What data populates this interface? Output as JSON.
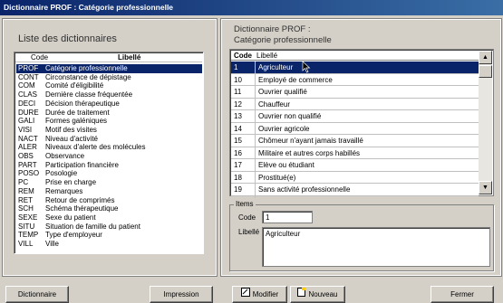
{
  "window": {
    "title": "Dictionnaire PROF : Catégorie professionnelle"
  },
  "left": {
    "title": "Liste des dictionnaires",
    "col_code": "Code",
    "col_label": "Libellé",
    "items": [
      {
        "code": "PROF",
        "label": "Catégorie professionnelle"
      },
      {
        "code": "CONT",
        "label": "Circonstance de dépistage"
      },
      {
        "code": "COM",
        "label": "Comité d'éligibilité"
      },
      {
        "code": "CLAS",
        "label": "Dernière classe fréquentée"
      },
      {
        "code": "DECI",
        "label": "Décision thérapeutique"
      },
      {
        "code": "DURE",
        "label": "Durée de traitement"
      },
      {
        "code": "GALI",
        "label": "Formes galéniques"
      },
      {
        "code": "VISI",
        "label": "Motif des visites"
      },
      {
        "code": "NACT",
        "label": "Niveau d'activité"
      },
      {
        "code": "ALER",
        "label": "Niveaux d'alerte des molécules"
      },
      {
        "code": "OBS",
        "label": "Observance"
      },
      {
        "code": "PART",
        "label": "Participation financière"
      },
      {
        "code": "POSO",
        "label": "Posologie"
      },
      {
        "code": "PC",
        "label": "Prise en charge"
      },
      {
        "code": "REM",
        "label": "Remarques"
      },
      {
        "code": "RET",
        "label": "Retour de comprimés"
      },
      {
        "code": "SCH",
        "label": "Schéma thérapeutique"
      },
      {
        "code": "SEXE",
        "label": "Sexe du patient"
      },
      {
        "code": "SITU",
        "label": "Situation de famille du patient"
      },
      {
        "code": "TEMP",
        "label": "Type d'employeur"
      },
      {
        "code": "VILL",
        "label": "Ville"
      }
    ]
  },
  "right": {
    "title_line1": "Dictionnaire PROF :",
    "title_line2": "Catégorie professionnelle",
    "col_code": "Code",
    "col_label": "Libellé",
    "rows": [
      {
        "code": "1",
        "label": "Agriculteur"
      },
      {
        "code": "10",
        "label": "Employé de commerce"
      },
      {
        "code": "11",
        "label": "Ouvrier qualifié"
      },
      {
        "code": "12",
        "label": "Chauffeur"
      },
      {
        "code": "13",
        "label": "Ouvrier non qualifié"
      },
      {
        "code": "14",
        "label": "Ouvrier agricole"
      },
      {
        "code": "15",
        "label": "Chômeur n'ayant jamais travaillé"
      },
      {
        "code": "16",
        "label": "Militaire et autres corps habillés"
      },
      {
        "code": "17",
        "label": "Elève ou étudiant"
      },
      {
        "code": "18",
        "label": "Prostitué(e)"
      },
      {
        "code": "19",
        "label": "Sans activité professionnelle"
      }
    ],
    "items_group": "Items",
    "code_label": "Code",
    "code_value": "1",
    "libelle_label": "Libellé",
    "libelle_value": "Agriculteur"
  },
  "buttons": {
    "dictionnaire": "Dictionnaire",
    "impression": "Impression",
    "modifier": "Modifier",
    "nouveau": "Nouveau",
    "fermer": "Fermer"
  },
  "colors": {
    "selection": "#0a246a",
    "titlebar": "#0a246a",
    "background": "#d4d0c8"
  }
}
